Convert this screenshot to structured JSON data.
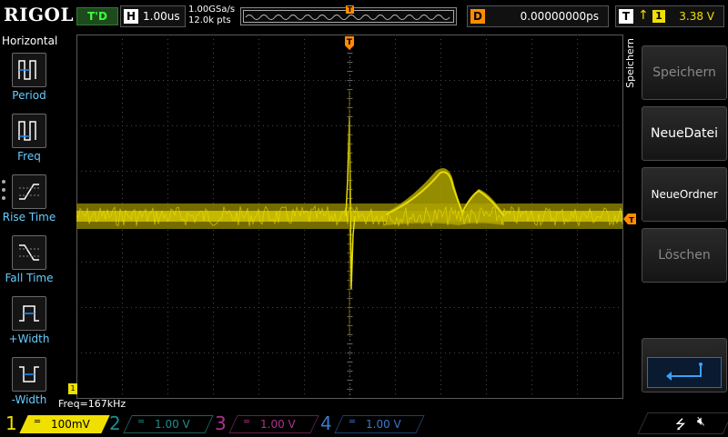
{
  "topbar": {
    "logo": "RIGOL",
    "run_status": "T'D",
    "horizontal": {
      "tag": "H",
      "value": "1.00us"
    },
    "sample_rate": "1.00GSa/s",
    "memory_depth": "12.0k pts",
    "delay": {
      "tag": "D",
      "value": "0.00000000ps"
    },
    "trigger": {
      "tag": "T",
      "edge": "rising",
      "source": "1",
      "level": "3.38 V"
    }
  },
  "left_menu": {
    "title": "Horizontal",
    "items": [
      {
        "label": "Period",
        "icon": "period-icon"
      },
      {
        "label": "Freq",
        "icon": "freq-icon"
      },
      {
        "label": "Rise Time",
        "icon": "rise-time-icon"
      },
      {
        "label": "Fall Time",
        "icon": "fall-time-icon"
      },
      {
        "label": "+Width",
        "icon": "plus-width-icon"
      },
      {
        "label": "-Width",
        "icon": "minus-width-icon"
      }
    ]
  },
  "right_menu": {
    "title": "Speichern",
    "buttons": [
      {
        "label": "Speichern",
        "state": "disabled"
      },
      {
        "label": "NeueDatei",
        "state": "enabled"
      },
      {
        "label": "NeueOrdner",
        "state": "enabled"
      },
      {
        "label": "Löschen",
        "state": "disabled"
      }
    ],
    "back_icon": "return-arrow-icon"
  },
  "measurement": {
    "freq": "Freq=167kHz"
  },
  "channels": [
    {
      "num": "1",
      "scale": "100mV",
      "color": "#f0e000",
      "active": true
    },
    {
      "num": "2",
      "scale": "1.00 V",
      "color": "#1f8e8e",
      "active": false
    },
    {
      "num": "3",
      "scale": "1.00 V",
      "color": "#b0328c",
      "active": false
    },
    {
      "num": "4",
      "scale": "1.00 V",
      "color": "#3a7acc",
      "active": false
    }
  ],
  "markers": {
    "trigger_position": "T",
    "trigger_level": "T",
    "ch1_ground": "1"
  },
  "status_icons": [
    "usb-icon",
    "speaker-muted-icon"
  ]
}
